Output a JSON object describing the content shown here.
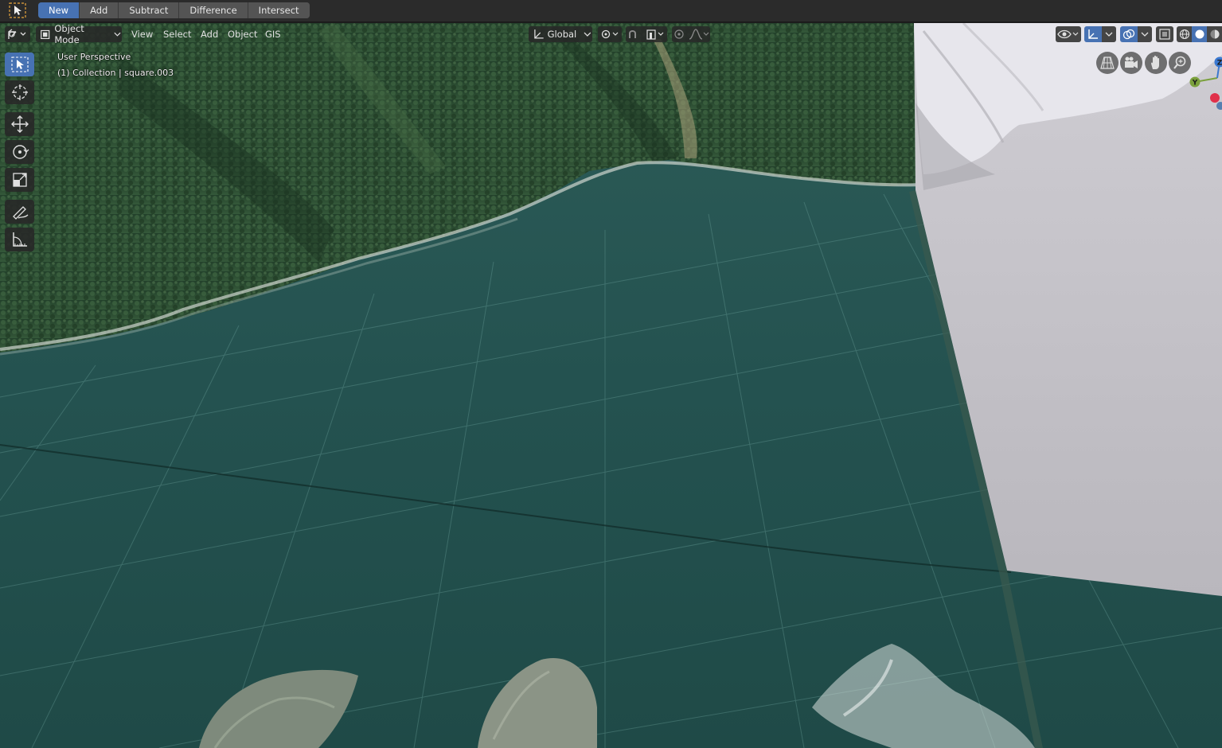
{
  "topbar": {
    "tool_icon": "select-box-icon",
    "boolean_buttons": [
      {
        "label": "New",
        "active": true
      },
      {
        "label": "Add",
        "active": false
      },
      {
        "label": "Subtract",
        "active": false
      },
      {
        "label": "Difference",
        "active": false
      },
      {
        "label": "Intersect",
        "active": false
      }
    ]
  },
  "viewport_header": {
    "editor_type_icon": "3d-viewport-icon",
    "mode": "Object Mode",
    "menus": [
      "View",
      "Select",
      "Add",
      "Object",
      "GIS"
    ],
    "transform_orientation": "Global",
    "pivot_icon": "pivot-icon",
    "snap_icon": "snap-magnet-icon",
    "proportional_icon": "proportional-edit-icon",
    "falloff_icon": "falloff-curve-icon",
    "visibility_icon": "eye-icon",
    "gizmo_icon": "gizmo-icon",
    "overlay_icon": "overlay-icon",
    "xray_icon": "xray-icon",
    "shading_icons": [
      "wireframe-shading-icon",
      "solid-shading-icon",
      "material-shading-icon"
    ]
  },
  "overlay": {
    "view_name": "User Perspective",
    "collection_info": "(1) Collection | square.003"
  },
  "toolbar": {
    "tools": [
      "select-box-icon",
      "cursor-icon",
      "move-icon",
      "rotate-icon",
      "scale-icon",
      "annotate-icon",
      "measure-icon"
    ]
  },
  "navigation": {
    "buttons": [
      "perspective-grid-icon",
      "camera-view-icon",
      "pan-hand-icon",
      "zoom-icon"
    ],
    "axes": {
      "y_label": "Y",
      "z_label": "Z"
    }
  },
  "colors": {
    "accent": "#4772b3",
    "water": "#24514f",
    "forest": "#2b4a2c",
    "mesh": "#c2c0c6",
    "header_bg": "#2b2b2b",
    "button_bg": "#545454"
  }
}
